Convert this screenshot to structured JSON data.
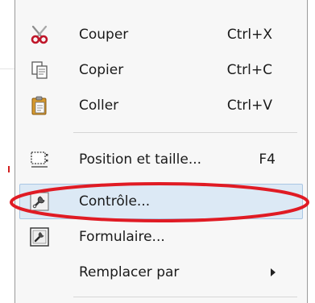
{
  "menu": {
    "items": [
      {
        "id": "cut",
        "label": "Couper",
        "shortcut": "Ctrl+X",
        "icon": "scissors-icon"
      },
      {
        "id": "copy",
        "label": "Copier",
        "shortcut": "Ctrl+C",
        "icon": "copy-icon"
      },
      {
        "id": "paste",
        "label": "Coller",
        "shortcut": "Ctrl+V",
        "icon": "clipboard-icon"
      },
      {
        "id": "position-size",
        "label": "Position et taille...",
        "shortcut": "F4",
        "icon": "position-size-icon"
      },
      {
        "id": "control",
        "label": "Contrôle...",
        "shortcut": "",
        "icon": "wrench-icon"
      },
      {
        "id": "form",
        "label": "Formulaire...",
        "shortcut": "",
        "icon": "form-icon"
      },
      {
        "id": "replace-with",
        "label": "Remplacer par",
        "shortcut": "",
        "icon": "",
        "has_submenu": true
      }
    ],
    "highlighted_item": "control"
  },
  "annotation": {
    "color": "#e01b24",
    "target": "control"
  },
  "colors": {
    "menu_background": "#f7f7f7",
    "highlight_background": "#dce9f5",
    "highlight_border": "#aac7e4"
  }
}
